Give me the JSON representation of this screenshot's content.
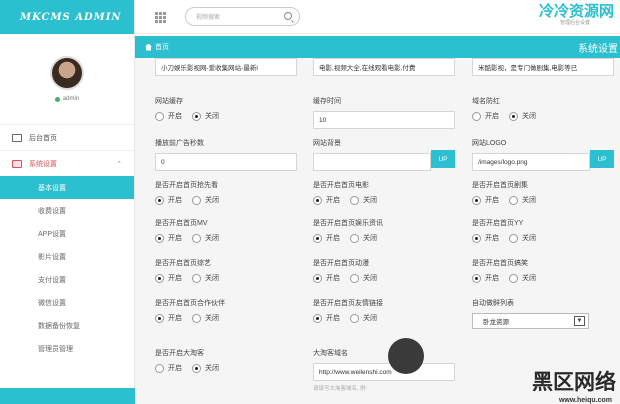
{
  "app": {
    "logo": "MKCMS ADMIN",
    "user": "admin"
  },
  "topbar": {
    "search_placeholder": "视频搜索",
    "watermark": "冷冷资源网",
    "watermark_sub": "管理后台设置"
  },
  "breadcrumb": {
    "home": "首页",
    "right_label": "系统设置"
  },
  "sidebar": {
    "items": [
      {
        "label": "后台首页"
      },
      {
        "label": "系统设置"
      }
    ],
    "sub_items": [
      "基本设置",
      "收费设置",
      "APP设置",
      "影片设置",
      "支付设置",
      "微信设置",
      "数据备份恢复",
      "管理员管理"
    ]
  },
  "radio_labels": {
    "on": "开启",
    "off": "关闭"
  },
  "top_inputs": [
    "小刀娱乐影视网-爱收集网站-最新l",
    "电影,视频大全,在线观看电影,付费",
    "米酷影视，是专门做剧集,电影等已"
  ],
  "fields": {
    "site_cache": {
      "label": "网站缓存",
      "value": "off"
    },
    "cache_time": {
      "label": "缓存时间",
      "value": "10"
    },
    "domain_guard": {
      "label": "域名防红",
      "value": "off"
    },
    "ad_seconds": {
      "label": "播放前广告秒数",
      "value": "0"
    },
    "bg": {
      "label": "网站背景",
      "value": "",
      "button": "UP"
    },
    "logo": {
      "label": "网站LOGO",
      "value": "/images/logo.png",
      "button": "UP"
    },
    "hot_preview": {
      "label": "是否开启首页抢先看",
      "value": "on"
    },
    "movie": {
      "label": "是否开启首页电影",
      "value": "on"
    },
    "series": {
      "label": "是否开启首页剧集",
      "value": "on"
    },
    "mv": {
      "label": "是否开启首页MV",
      "value": "on"
    },
    "ent": {
      "label": "是否开启首页娱乐资讯",
      "value": "on"
    },
    "yy": {
      "label": "是否开启首页YY",
      "value": "on"
    },
    "variety": {
      "label": "是否开启首页综艺",
      "value": "on"
    },
    "anime": {
      "label": "是否开启首页动漫",
      "value": "on"
    },
    "funny": {
      "label": "是否开启首页搞笑",
      "value": "on"
    },
    "partners": {
      "label": "是否开启首页合作伙伴",
      "value": "on"
    },
    "links": {
      "label": "是否开启首页友情链接",
      "value": "on"
    },
    "auto_collect": {
      "label": "自动做鲜列表",
      "value": "卧龙资源"
    },
    "taoke": {
      "label": "是否开启大淘客",
      "value": "off"
    },
    "taoke_domain": {
      "label": "大淘客域名",
      "value": "http://www.weilenshi.com",
      "hint": "请填写大淘客域名, 例:"
    }
  },
  "footer_watermark": {
    "text": "黑区网络",
    "url": "www.heiqu.com"
  }
}
